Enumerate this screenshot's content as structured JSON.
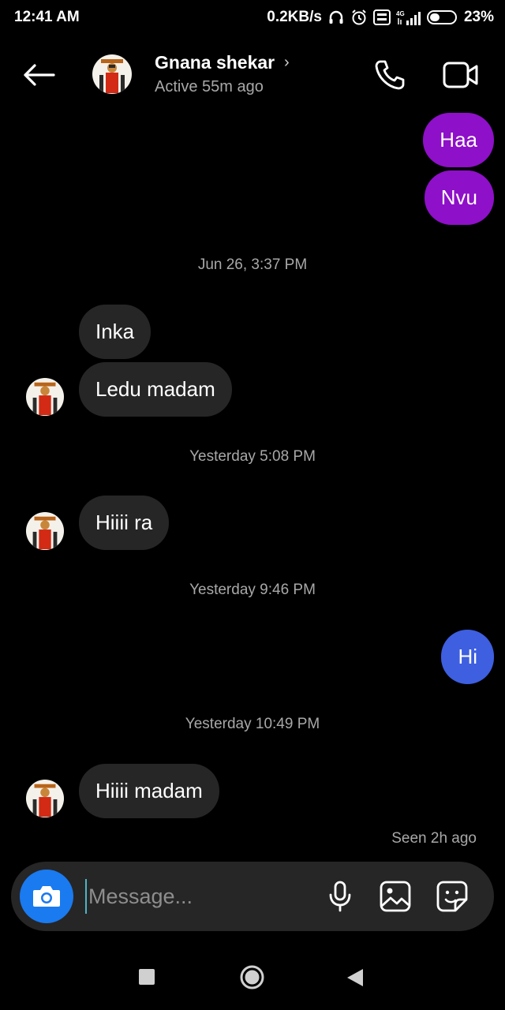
{
  "status_bar": {
    "time": "12:41 AM",
    "speed": "0.2KB/s",
    "network": "4G",
    "battery": "23%"
  },
  "header": {
    "contact_name": "Gnana shekar",
    "chevron": "›",
    "active_status": "Active 55m ago",
    "icons": [
      "back-arrow-icon",
      "phone-icon",
      "video-camera-icon"
    ]
  },
  "messages": [
    {
      "type": "outgoing",
      "text": "Haa"
    },
    {
      "type": "outgoing",
      "text": "Nvu"
    },
    {
      "type": "timestamp",
      "text": "Jun 26, 3:37 PM"
    },
    {
      "type": "incoming",
      "text": "Inka"
    },
    {
      "type": "incoming",
      "text": "Ledu madam"
    },
    {
      "type": "timestamp",
      "text": "Yesterday 5:08 PM"
    },
    {
      "type": "incoming",
      "text": "Hiiii ra"
    },
    {
      "type": "timestamp",
      "text": "Yesterday 9:46 PM"
    },
    {
      "type": "outgoing",
      "text": "Hi"
    },
    {
      "type": "timestamp",
      "text": "Yesterday 10:49 PM"
    },
    {
      "type": "incoming",
      "text": "Hiiii madam"
    }
  ],
  "seen": "Seen 2h ago",
  "composer": {
    "placeholder": "Message...",
    "icons": [
      "camera-icon",
      "microphone-icon",
      "image-icon",
      "sticker-icon"
    ]
  },
  "colors": {
    "background": "#000000",
    "incoming_bubble": "#262626",
    "outgoing_bubble_purple": "#8e10c8",
    "outgoing_bubble_blue": "#3d5fe0",
    "camera_button": "#1a7af0",
    "secondary_text": "#a8a8a8"
  }
}
